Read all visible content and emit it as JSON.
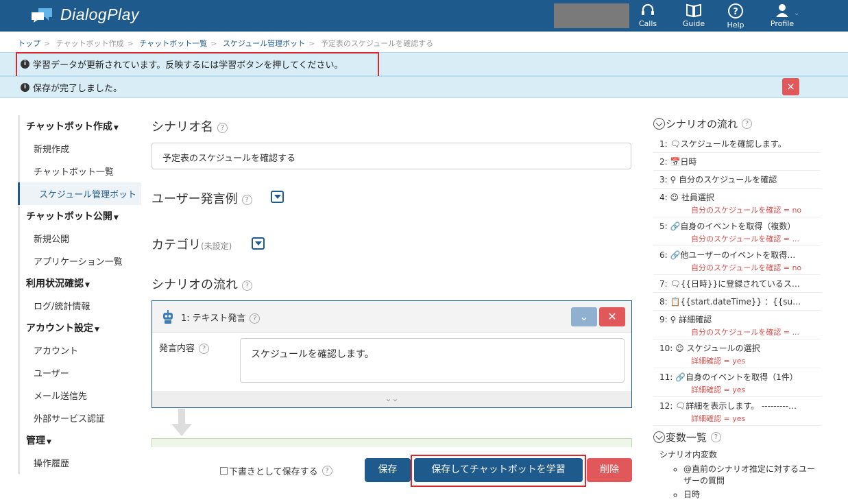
{
  "header": {
    "app_title": "DialogPlay",
    "nav": [
      {
        "label": "Calls",
        "icon": "headset-icon"
      },
      {
        "label": "Guide",
        "icon": "book-icon"
      },
      {
        "label": "Help",
        "icon": "help-icon"
      },
      {
        "label": "Profile",
        "icon": "user-icon"
      }
    ]
  },
  "breadcrumb": [
    "トップ",
    "チャットボット作成",
    "チャットボット一覧",
    "スケジュール管理ボット",
    "予定表のスケジュールを確認する"
  ],
  "alerts": {
    "training": "学習データが更新されています。反映するには学習ボタンを押してください。",
    "saved": "保存が完了しました。",
    "close_label": "×"
  },
  "sidebar": {
    "sections": [
      {
        "title": "チャットボット作成",
        "items": [
          "新規作成",
          "チャットボット一覧",
          "スケジュール管理ボット"
        ]
      },
      {
        "title": "チャットボット公開",
        "items": [
          "新規公開",
          "アプリケーション一覧"
        ]
      },
      {
        "title": "利用状況確認",
        "items": [
          "ログ/統計情報"
        ]
      },
      {
        "title": "アカウント設定",
        "items": [
          "アカウント",
          "ユーザー",
          "メール送信先",
          "外部サービス認証"
        ]
      },
      {
        "title": "管理",
        "items": [
          "操作履歴"
        ]
      }
    ]
  },
  "main": {
    "scenario_name_label": "シナリオ名",
    "scenario_name_value": "予定表のスケジュールを確認する",
    "utterance_label": "ユーザー発言例",
    "category_label": "カテゴリ",
    "category_note": "(未設定)",
    "flow_label": "シナリオの流れ",
    "step1_title": "1: テキスト発言",
    "say_label": "発言内容",
    "say_value": "スケジュールを確認します。",
    "draft_label": "下書きとして保存する",
    "save_button": "保存",
    "save_train_button": "保存してチャットボットを学習",
    "delete_button": "削除"
  },
  "right_panel": {
    "flow_title": "シナリオの流れ",
    "flow": [
      {
        "text": "1: 🗨スケジュールを確認します。",
        "cond": ""
      },
      {
        "text": "2: 📅日時",
        "cond": ""
      },
      {
        "text": "3: ⚲ 自分のスケジュールを確認",
        "cond": ""
      },
      {
        "text": "4: ☺ 社員選択",
        "cond": "自分のスケジュールを確認 = no"
      },
      {
        "text": "5: 🔗自身のイベントを取得（複数）",
        "cond": "自分のスケジュールを確認 = ..."
      },
      {
        "text": "6: 🔗他ユーザーのイベントを取得…",
        "cond": "自分のスケジュールを確認 = no"
      },
      {
        "text": "7: 🗨{{日時}}に登録されているス…",
        "cond": ""
      },
      {
        "text": "8: 📋{{start.dateTime}} ：{{su…",
        "cond": ""
      },
      {
        "text": "9: ⚲ 詳細確認",
        "cond": "自分のスケジュールを確認 = ..."
      },
      {
        "text": "10: ☺ スケジュールの選択",
        "cond": "詳細確認 = yes"
      },
      {
        "text": "11: 🔗自身のイベントを取得（1件）",
        "cond": "詳細確認 = yes"
      },
      {
        "text": "12: 🗨詳細を表示します。 ---------…",
        "cond": "詳細確認 = yes"
      }
    ],
    "vars_title": "変数一覧",
    "vars_group": "シナリオ内変数",
    "vars": [
      "@直前のシナリオ推定に対するユーザーの質問",
      "日時"
    ]
  }
}
